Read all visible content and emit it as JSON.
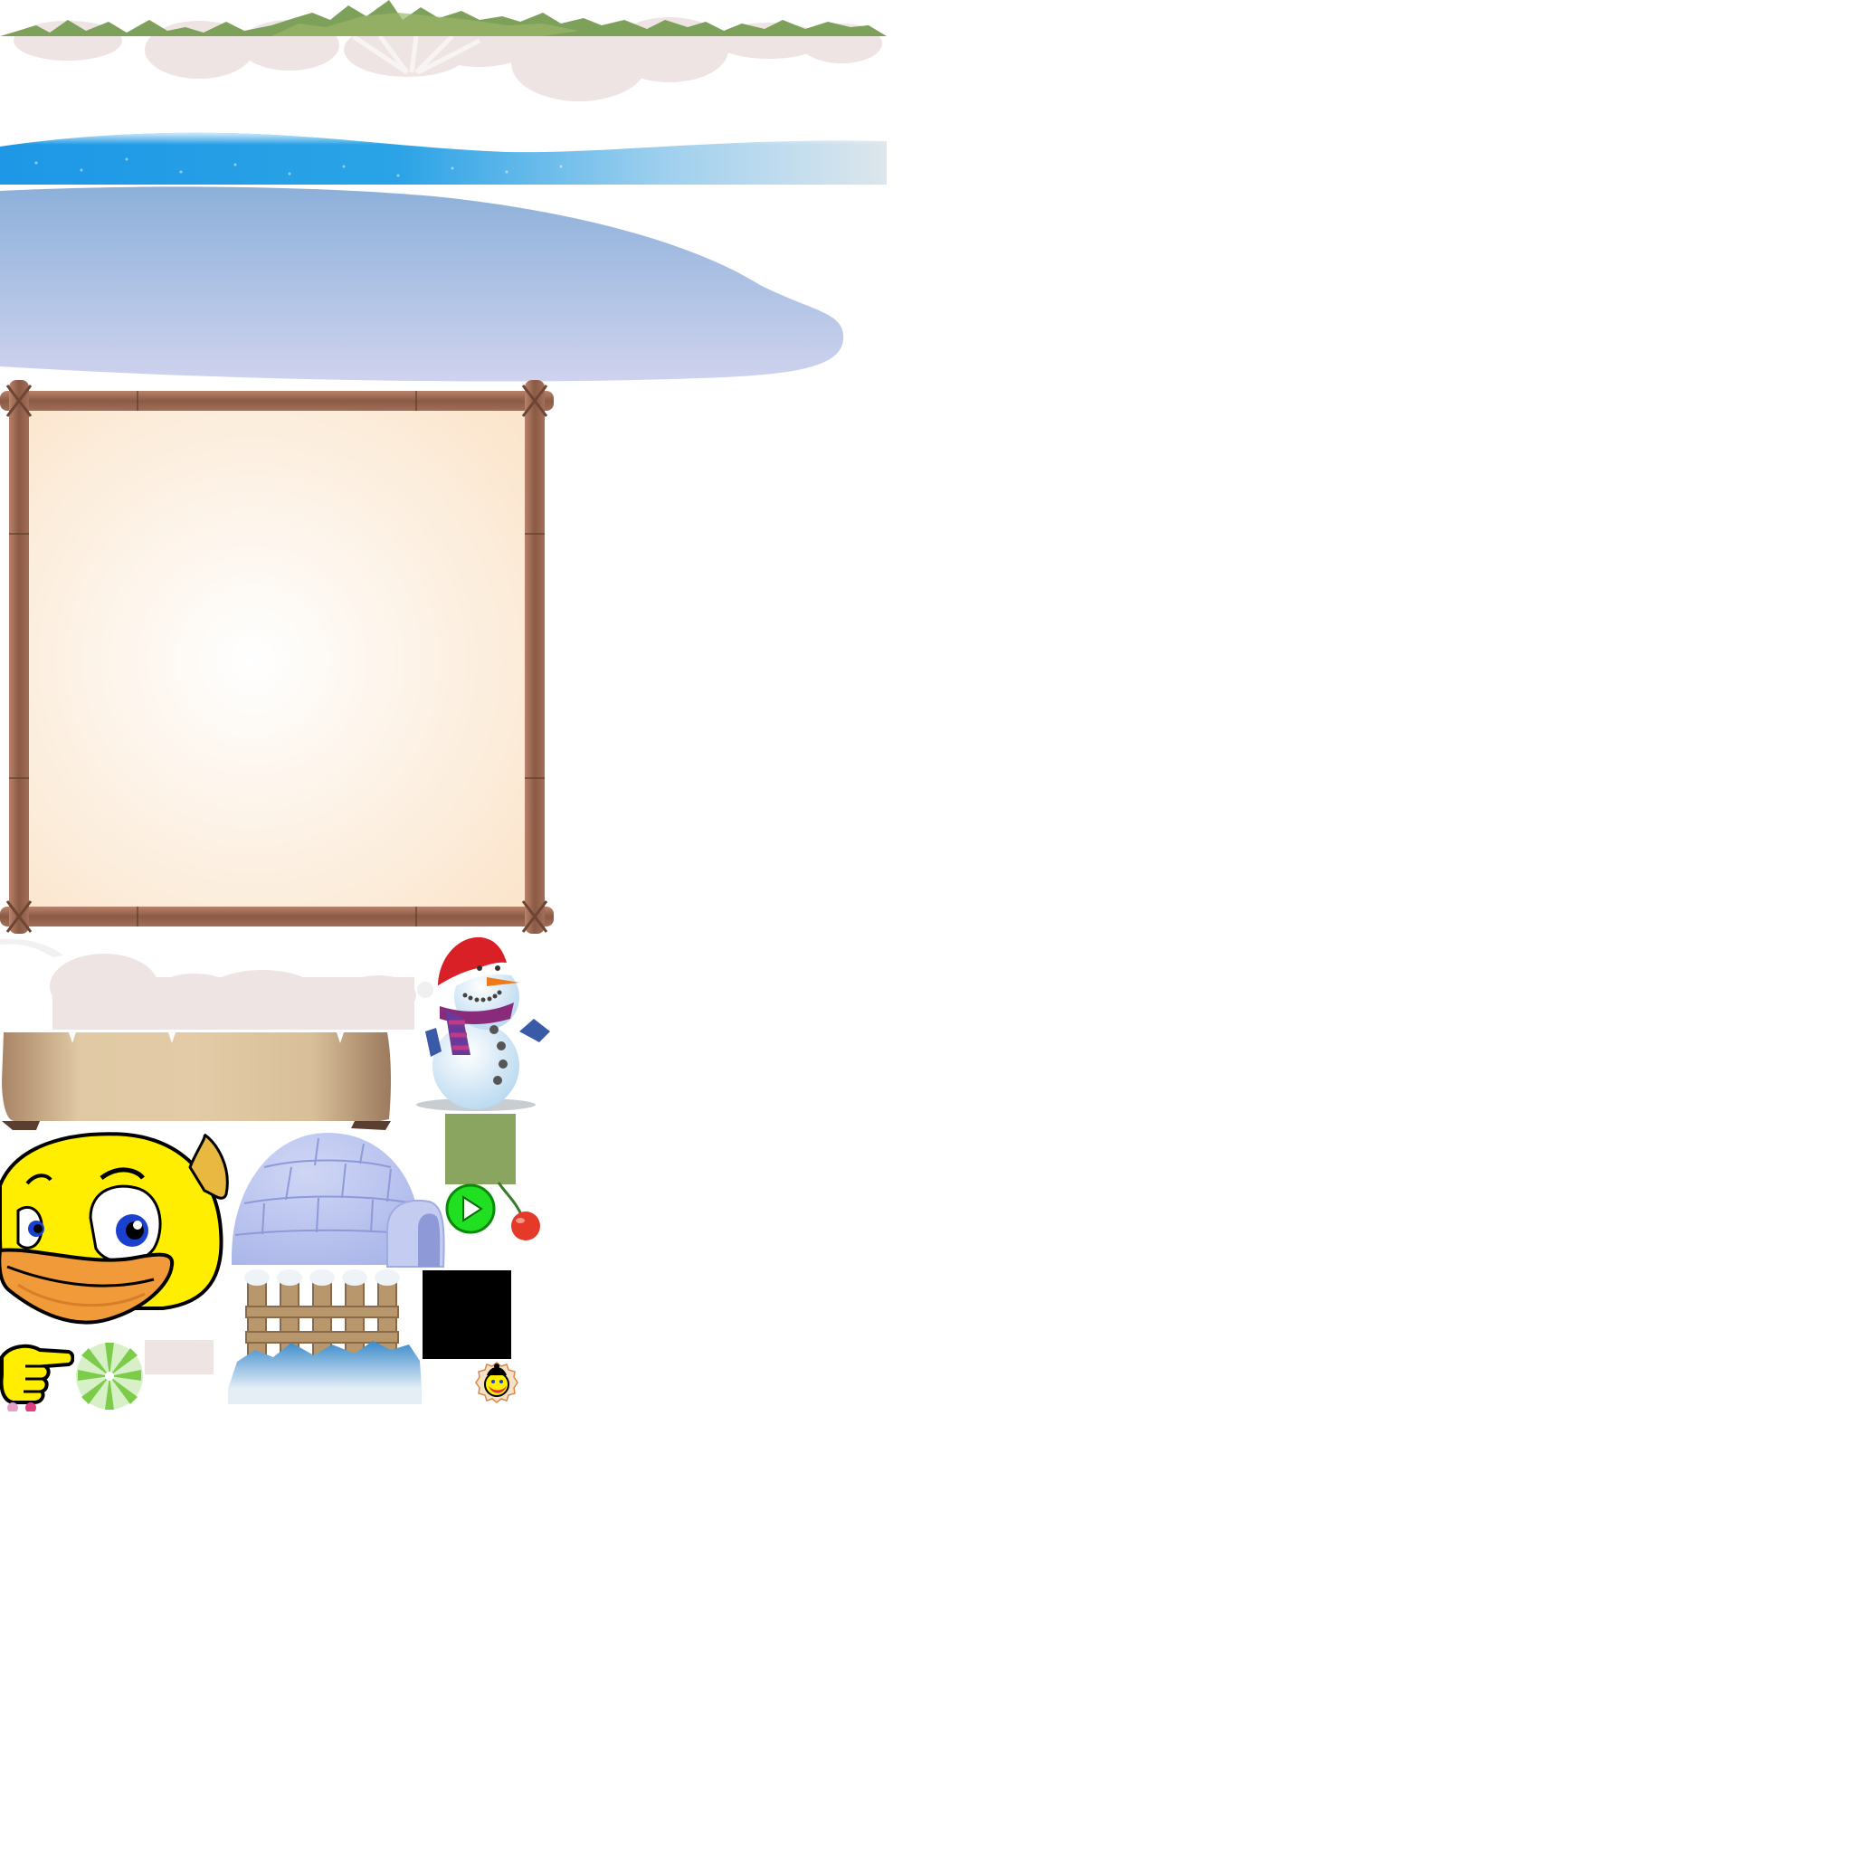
{
  "atlas": {
    "background": "#ffffff",
    "sprites": [
      {
        "name": "grass-snow-strip",
        "description_icon": "grass-strip-icon"
      },
      {
        "name": "water-strip",
        "description_icon": "water-wave-icon"
      },
      {
        "name": "ice-field",
        "description_icon": "ice-icon"
      },
      {
        "name": "wooden-frame-panel",
        "description_icon": "frame-icon"
      },
      {
        "name": "snow-cloud-strip",
        "description_icon": "cloud-icon"
      },
      {
        "name": "parchment-banner",
        "description_icon": "banner-icon"
      },
      {
        "name": "snowman",
        "description_icon": "snowman-icon"
      },
      {
        "name": "green-tile",
        "description_icon": "tile-icon"
      },
      {
        "name": "duck-face",
        "description_icon": "duck-icon"
      },
      {
        "name": "igloo",
        "description_icon": "igloo-icon"
      },
      {
        "name": "play-button",
        "description_icon": "play-icon"
      },
      {
        "name": "cherry",
        "description_icon": "cherry-icon"
      },
      {
        "name": "snowy-fence",
        "description_icon": "fence-icon"
      },
      {
        "name": "black-tile",
        "description_icon": "black-square-icon"
      },
      {
        "name": "pointing-hand",
        "description_icon": "hand-pointer-icon"
      },
      {
        "name": "green-starburst",
        "description_icon": "starburst-icon"
      },
      {
        "name": "pink-swatch",
        "description_icon": "swatch-icon"
      },
      {
        "name": "duck-badge",
        "description_icon": "duck-badge-icon"
      }
    ],
    "colors": {
      "grass": "#7da05a",
      "cloud": "#efe4e4",
      "water": "#2ba3e6",
      "ice_top": "#8fb1dc",
      "ice_bottom": "#cdd2ee",
      "wood": "#9a6a55",
      "panel": "#fdf1e2",
      "tile_green": "#8aa55f",
      "play_green": "#21e021",
      "duck_yellow": "#ffee00",
      "duck_beak": "#f09a3a",
      "igloo": "#b9c3ef",
      "cherry": "#e53a2a"
    }
  }
}
